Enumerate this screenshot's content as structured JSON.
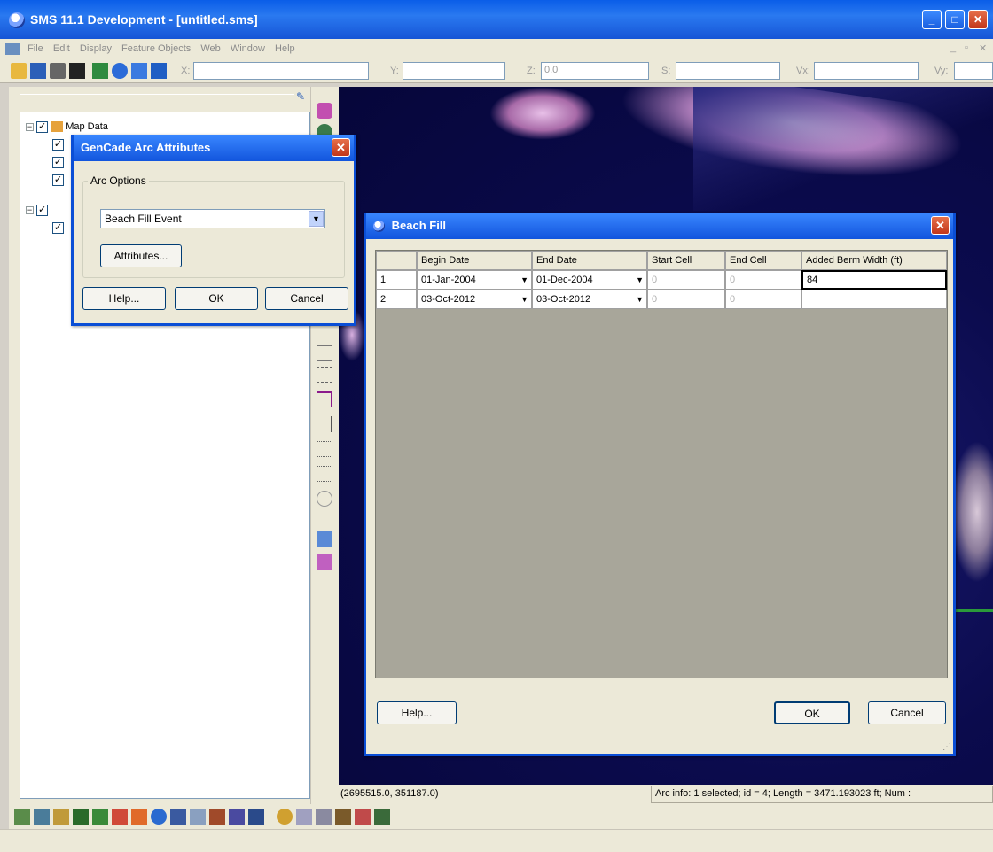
{
  "window": {
    "title": "SMS 11.1 Development - [untitled.sms]"
  },
  "menu": [
    "File",
    "Edit",
    "Display",
    "Feature Objects",
    "Web",
    "Window",
    "Help"
  ],
  "toolbar": {
    "x_label": "X:",
    "x_value": "",
    "y_label": "Y:",
    "y_value": "",
    "z_label": "Z:",
    "z_value": "0.0",
    "s_label": "S:",
    "s_value": "",
    "vx_label": "Vx:",
    "vx_value": "",
    "vy_label": "Vy:",
    "vy_value": ""
  },
  "tree": {
    "map_data": "Map Data"
  },
  "arc_dialog": {
    "title": "GenCade Arc Attributes",
    "group_label": "Arc Options",
    "selected_option": "Beach Fill Event",
    "attributes_button": "Attributes...",
    "help_button": "Help...",
    "ok_button": "OK",
    "cancel_button": "Cancel"
  },
  "beach_fill_dialog": {
    "title": "Beach Fill",
    "columns": [
      "Begin Date",
      "End Date",
      "Start Cell",
      "End Cell",
      "Added Berm Width (ft)"
    ],
    "rows": [
      {
        "num": "1",
        "begin": "01-Jan-2004",
        "end": "01-Dec-2004",
        "start_cell": "0",
        "end_cell": "0",
        "width": "84"
      },
      {
        "num": "2",
        "begin": "03-Oct-2012",
        "end": "03-Oct-2012",
        "start_cell": "0",
        "end_cell": "0",
        "width": ""
      }
    ],
    "help_button": "Help...",
    "ok_button": "OK",
    "cancel_button": "Cancel"
  },
  "status": {
    "coords": "(2695515.0, 351187.0)",
    "arc_info": "Arc info: 1 selected; id = 4; Length = 3471.193023 ft; Num :"
  },
  "colors": {
    "titlebar": "#0a5de8",
    "dialog_bg": "#ece9d8",
    "map_bg": "#0b0b4d"
  }
}
